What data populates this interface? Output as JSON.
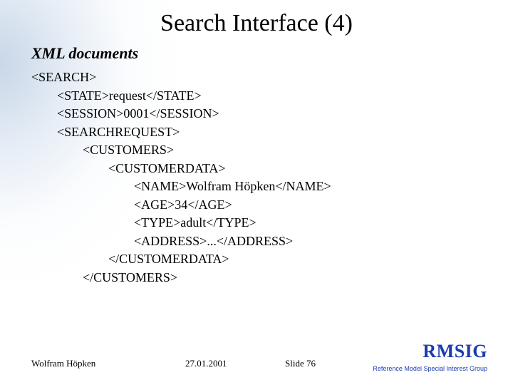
{
  "title": "Search Interface (4)",
  "subtitle": "XML documents",
  "xml": {
    "l0": "<SEARCH>",
    "l1": "<STATE>request</STATE>",
    "l2": "<SESSION>0001</SESSION>",
    "l3": "<SEARCHREQUEST>",
    "l4": "<CUSTOMERS>",
    "l5": "<CUSTOMERDATA>",
    "l6": "<NAME>Wolfram Höpken</NAME>",
    "l7": "<AGE>34</AGE>",
    "l8": "<TYPE>adult</TYPE>",
    "l9": "<ADDRESS>...</ADDRESS>",
    "l10": "</CUSTOMERDATA>",
    "l11": "</CUSTOMERS>"
  },
  "footer": {
    "author": "Wolfram Höpken",
    "date": "27.01.2001",
    "slide": "Slide 76",
    "logo": "RMSIG",
    "tagline": "Reference Model Special Interest Group"
  }
}
